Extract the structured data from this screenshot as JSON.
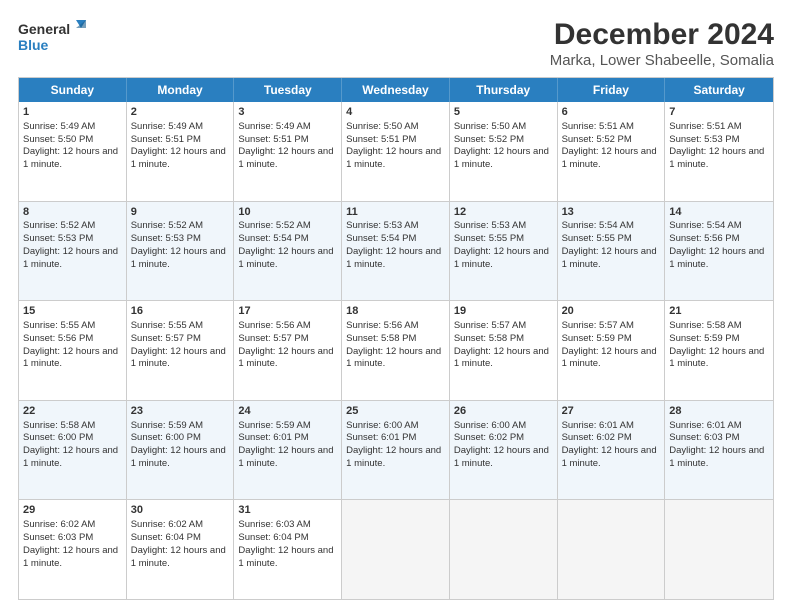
{
  "logo": {
    "line1": "General",
    "line2": "Blue"
  },
  "title": "December 2024",
  "subtitle": "Marka, Lower Shabeelle, Somalia",
  "days": [
    "Sunday",
    "Monday",
    "Tuesday",
    "Wednesday",
    "Thursday",
    "Friday",
    "Saturday"
  ],
  "weeks": [
    {
      "alt": false,
      "cells": [
        {
          "day": 1,
          "rise": "5:49 AM",
          "set": "5:50 PM",
          "daylight": "12 hours and 1 minute."
        },
        {
          "day": 2,
          "rise": "5:49 AM",
          "set": "5:51 PM",
          "daylight": "12 hours and 1 minute."
        },
        {
          "day": 3,
          "rise": "5:49 AM",
          "set": "5:51 PM",
          "daylight": "12 hours and 1 minute."
        },
        {
          "day": 4,
          "rise": "5:50 AM",
          "set": "5:51 PM",
          "daylight": "12 hours and 1 minute."
        },
        {
          "day": 5,
          "rise": "5:50 AM",
          "set": "5:52 PM",
          "daylight": "12 hours and 1 minute."
        },
        {
          "day": 6,
          "rise": "5:51 AM",
          "set": "5:52 PM",
          "daylight": "12 hours and 1 minute."
        },
        {
          "day": 7,
          "rise": "5:51 AM",
          "set": "5:53 PM",
          "daylight": "12 hours and 1 minute."
        }
      ]
    },
    {
      "alt": true,
      "cells": [
        {
          "day": 8,
          "rise": "5:52 AM",
          "set": "5:53 PM",
          "daylight": "12 hours and 1 minute."
        },
        {
          "day": 9,
          "rise": "5:52 AM",
          "set": "5:53 PM",
          "daylight": "12 hours and 1 minute."
        },
        {
          "day": 10,
          "rise": "5:52 AM",
          "set": "5:54 PM",
          "daylight": "12 hours and 1 minute."
        },
        {
          "day": 11,
          "rise": "5:53 AM",
          "set": "5:54 PM",
          "daylight": "12 hours and 1 minute."
        },
        {
          "day": 12,
          "rise": "5:53 AM",
          "set": "5:55 PM",
          "daylight": "12 hours and 1 minute."
        },
        {
          "day": 13,
          "rise": "5:54 AM",
          "set": "5:55 PM",
          "daylight": "12 hours and 1 minute."
        },
        {
          "day": 14,
          "rise": "5:54 AM",
          "set": "5:56 PM",
          "daylight": "12 hours and 1 minute."
        }
      ]
    },
    {
      "alt": false,
      "cells": [
        {
          "day": 15,
          "rise": "5:55 AM",
          "set": "5:56 PM",
          "daylight": "12 hours and 1 minute."
        },
        {
          "day": 16,
          "rise": "5:55 AM",
          "set": "5:57 PM",
          "daylight": "12 hours and 1 minute."
        },
        {
          "day": 17,
          "rise": "5:56 AM",
          "set": "5:57 PM",
          "daylight": "12 hours and 1 minute."
        },
        {
          "day": 18,
          "rise": "5:56 AM",
          "set": "5:58 PM",
          "daylight": "12 hours and 1 minute."
        },
        {
          "day": 19,
          "rise": "5:57 AM",
          "set": "5:58 PM",
          "daylight": "12 hours and 1 minute."
        },
        {
          "day": 20,
          "rise": "5:57 AM",
          "set": "5:59 PM",
          "daylight": "12 hours and 1 minute."
        },
        {
          "day": 21,
          "rise": "5:58 AM",
          "set": "5:59 PM",
          "daylight": "12 hours and 1 minute."
        }
      ]
    },
    {
      "alt": true,
      "cells": [
        {
          "day": 22,
          "rise": "5:58 AM",
          "set": "6:00 PM",
          "daylight": "12 hours and 1 minute."
        },
        {
          "day": 23,
          "rise": "5:59 AM",
          "set": "6:00 PM",
          "daylight": "12 hours and 1 minute."
        },
        {
          "day": 24,
          "rise": "5:59 AM",
          "set": "6:01 PM",
          "daylight": "12 hours and 1 minute."
        },
        {
          "day": 25,
          "rise": "6:00 AM",
          "set": "6:01 PM",
          "daylight": "12 hours and 1 minute."
        },
        {
          "day": 26,
          "rise": "6:00 AM",
          "set": "6:02 PM",
          "daylight": "12 hours and 1 minute."
        },
        {
          "day": 27,
          "rise": "6:01 AM",
          "set": "6:02 PM",
          "daylight": "12 hours and 1 minute."
        },
        {
          "day": 28,
          "rise": "6:01 AM",
          "set": "6:03 PM",
          "daylight": "12 hours and 1 minute."
        }
      ]
    },
    {
      "alt": false,
      "cells": [
        {
          "day": 29,
          "rise": "6:02 AM",
          "set": "6:03 PM",
          "daylight": "12 hours and 1 minute."
        },
        {
          "day": 30,
          "rise": "6:02 AM",
          "set": "6:04 PM",
          "daylight": "12 hours and 1 minute."
        },
        {
          "day": 31,
          "rise": "6:03 AM",
          "set": "6:04 PM",
          "daylight": "12 hours and 1 minute."
        },
        {
          "day": null
        },
        {
          "day": null
        },
        {
          "day": null
        },
        {
          "day": null
        }
      ]
    }
  ]
}
